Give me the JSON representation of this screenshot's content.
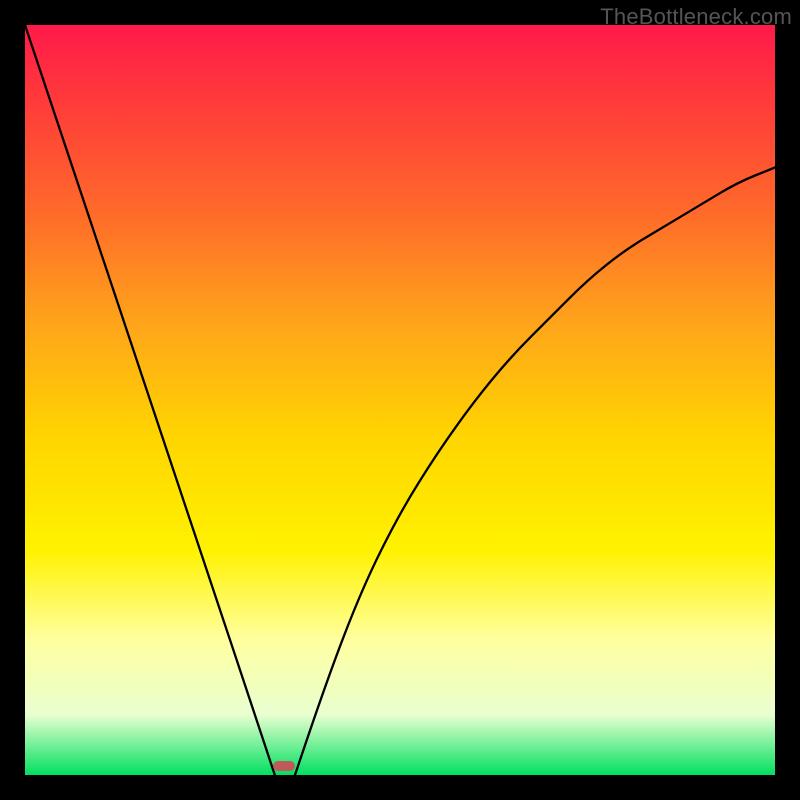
{
  "watermark": {
    "text": "TheBottleneck.com"
  },
  "chart_data": {
    "type": "line",
    "title": "",
    "xlabel": "",
    "ylabel": "",
    "xlim": [
      0,
      1
    ],
    "ylim": [
      0,
      1
    ],
    "grid": false,
    "series": [
      {
        "name": "bottleneck-curve-left",
        "x": [
          0.0,
          0.05,
          0.1,
          0.15,
          0.2,
          0.25,
          0.3,
          0.333
        ],
        "values": [
          1.0,
          0.85,
          0.7,
          0.55,
          0.4,
          0.25,
          0.1,
          0.0
        ]
      },
      {
        "name": "bottleneck-curve-right",
        "x": [
          0.36,
          0.4,
          0.45,
          0.5,
          0.55,
          0.6,
          0.65,
          0.7,
          0.75,
          0.8,
          0.85,
          0.9,
          0.95,
          1.0
        ],
        "values": [
          0.0,
          0.12,
          0.25,
          0.35,
          0.43,
          0.5,
          0.56,
          0.61,
          0.66,
          0.7,
          0.73,
          0.76,
          0.79,
          0.81
        ]
      }
    ],
    "marker": {
      "u": 0.345,
      "v": 0.012,
      "color": "#c05a5a"
    },
    "background_gradient": {
      "top": "#ff1a4a",
      "mid": "#fff200",
      "bottom": "#00e060"
    }
  }
}
